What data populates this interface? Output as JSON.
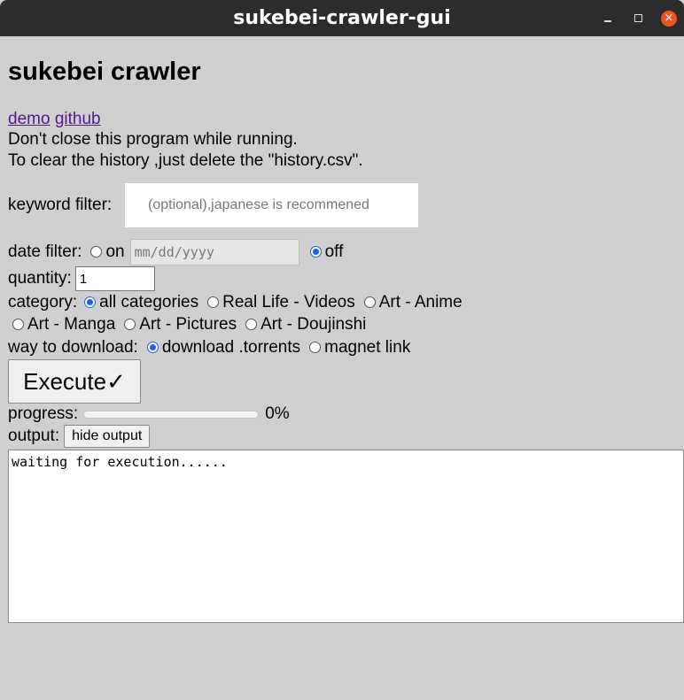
{
  "window": {
    "title": "sukebei-crawler-gui",
    "close_glyph": "×"
  },
  "heading": "sukebei crawler",
  "links": {
    "demo": "demo",
    "github": "github"
  },
  "notices": [
    "Don't close this program while running.",
    "To clear the history ,just delete the \"history.csv\"."
  ],
  "keyword": {
    "label": "keyword filter:",
    "placeholder": "(optional),japanese is recommened"
  },
  "date": {
    "label": "date filter:",
    "on_label": "on",
    "placeholder": "mm/dd/yyyy",
    "off_label": "off",
    "selected": "off"
  },
  "quantity": {
    "label": "quantity:",
    "value": "1"
  },
  "category": {
    "label": "category:",
    "options": [
      "all categories",
      "Real Life - Videos",
      "Art - Anime",
      "Art - Manga",
      "Art - Pictures",
      "Art - Doujinshi"
    ],
    "selected": "all categories"
  },
  "download": {
    "label": "way to download:",
    "options": [
      "download .torrents",
      "magnet link"
    ],
    "selected": "download .torrents"
  },
  "execute": {
    "label": "Execute✓"
  },
  "progress": {
    "label": "progress:",
    "value_text": "0%",
    "fraction": 0
  },
  "output": {
    "label": "output:",
    "hide_label": "hide output",
    "text": "waiting for execution......"
  },
  "colors": {
    "radio_accent": "#1a5cff",
    "link": "#551a8b",
    "titlebar": "#2c2c2c",
    "close": "#e95420",
    "background": "#cfcfcf"
  }
}
